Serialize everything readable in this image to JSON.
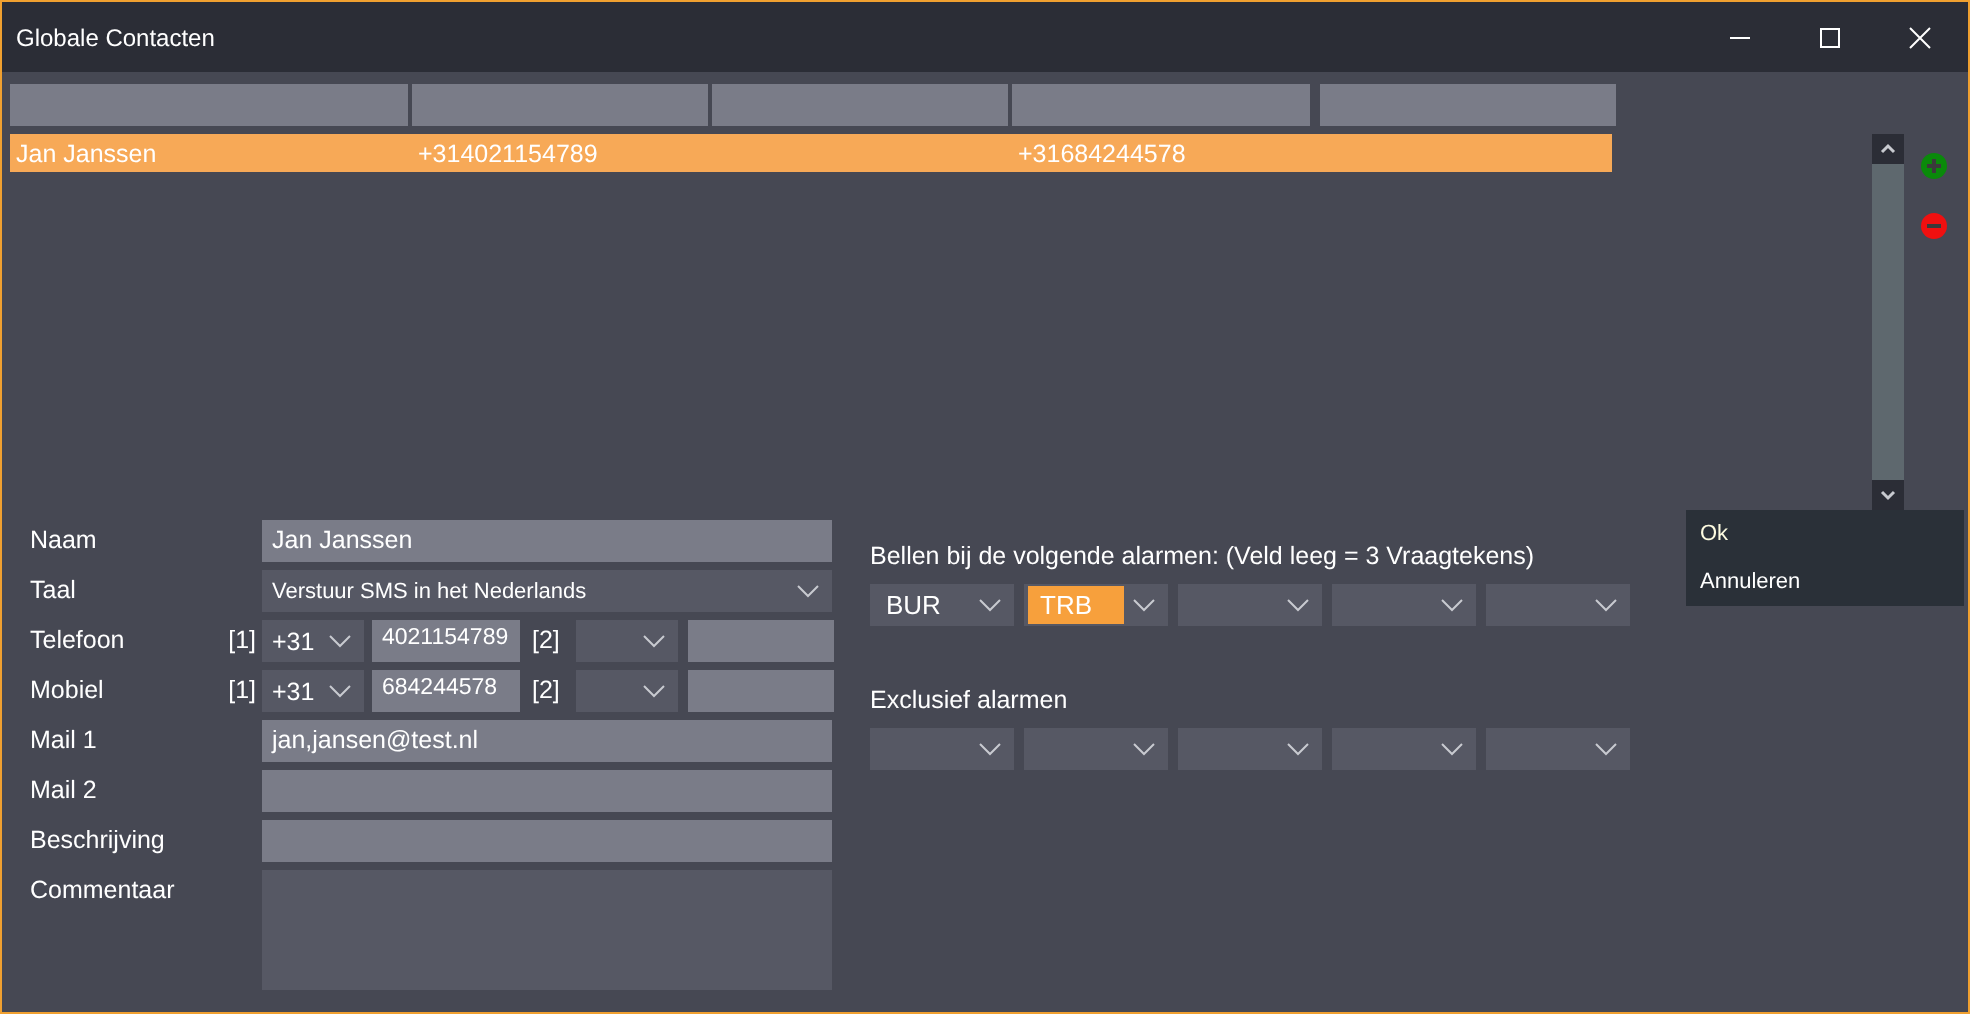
{
  "window": {
    "title": "Globale Contacten"
  },
  "contacts": [
    {
      "name": "Jan Janssen",
      "phone": "+314021154789",
      "mobile": "+31684244578",
      "selected": true
    }
  ],
  "form": [
    {
      "kind": "text",
      "label": "Naam",
      "value": "Jan Janssen"
    },
    {
      "kind": "select",
      "label": "Taal",
      "value": "Verstuur SMS in het Nederlands"
    },
    {
      "kind": "phone",
      "label": "Telefoon",
      "index1": "[1]",
      "country": "+31",
      "number": "4021154789",
      "index2": "[2]"
    },
    {
      "kind": "phone",
      "label": "Mobiel",
      "index1": "[1]",
      "country": "+31",
      "number": "684244578",
      "index2": "[2]"
    },
    {
      "kind": "text",
      "label": "Mail 1",
      "value": "jan,jansen@test.nl"
    },
    {
      "kind": "text",
      "label": "Mail 2"
    },
    {
      "kind": "text",
      "label": "Beschrijving"
    },
    {
      "kind": "textarea",
      "label": "Commentaar"
    }
  ],
  "alarms": [
    {
      "title": "Bellen bij de volgende alarmen: (Veld leeg = 3 Vraagtekens)",
      "dropdowns": [
        {
          "value": "BUR",
          "selected": false
        },
        {
          "value": "TRB",
          "selected": true
        },
        {
          "selected": false
        },
        {
          "selected": false
        },
        {
          "selected": false
        }
      ]
    },
    {
      "title": "Exclusief alarmen",
      "dropdowns": [
        {
          "selected": false
        },
        {
          "selected": false
        },
        {
          "selected": false
        },
        {
          "selected": false
        },
        {
          "selected": false
        }
      ]
    }
  ],
  "buttons": [
    "Ok",
    "Annuleren"
  ]
}
